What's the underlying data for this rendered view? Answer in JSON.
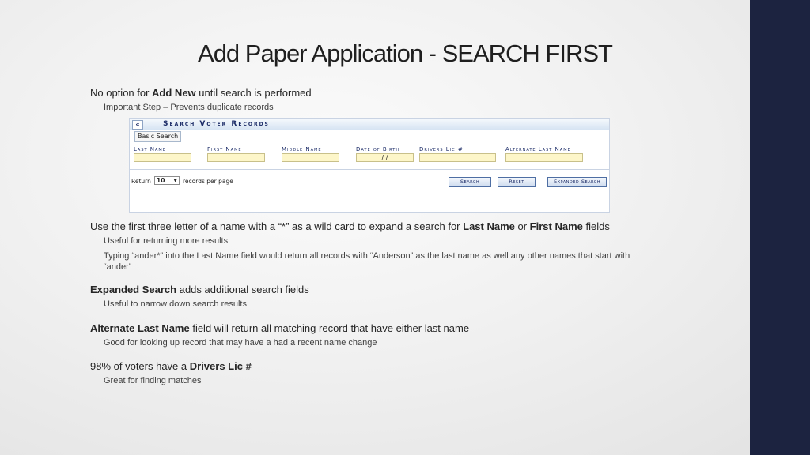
{
  "title": "Add Paper Application - SEARCH FIRST",
  "bullets": {
    "b1": {
      "pre": "No option for ",
      "bold": "Add New",
      "post": " until search is performed"
    },
    "b1_sub": "Important Step – Prevents duplicate records",
    "b2": {
      "pre": "Use the first three letter of a name with a “*” as a wild card to expand a search for ",
      "bold1": "Last Name",
      "mid": " or ",
      "bold2": "First Name",
      "post": " fields"
    },
    "b2_sub1": "Useful for returning more results",
    "b2_sub2": "Typing “ander*” into the Last Name field would return all records with “Anderson” as the last name as well any other names that start with “ander”",
    "b3": {
      "bold": "Expanded Search",
      "post": " adds additional search fields"
    },
    "b3_sub": "Useful to narrow down search results",
    "b4": {
      "bold": "Alternate Last Name",
      "post": " field will return all matching record that have either last name"
    },
    "b4_sub": "Good for looking up record that may have a had a recent name change",
    "b5": {
      "pre": "98% of voters have a ",
      "bold": "Drivers Lic #"
    },
    "b5_sub": "Great for finding matches"
  },
  "search_panel": {
    "collapse": "«",
    "title": "Search Voter Records",
    "tab": "Basic Search",
    "fields": {
      "last_name": "Last Name",
      "first_name": "First Name",
      "middle_name": "Middle Name",
      "dob": "Date of Birth",
      "dob_value": "/     /",
      "drivers_lic": "Drivers Lic #",
      "alt_last_name": "Alternate Last Name"
    },
    "return_label": "Return",
    "return_value": "10",
    "records_label": "records per page",
    "buttons": {
      "search": "Search",
      "reset": "Reset",
      "expanded": "Expanded Search"
    }
  },
  "colors": {
    "accent_bar": "#1c2340",
    "field_bg": "#fdf6c9",
    "label": "#1a2a66"
  }
}
